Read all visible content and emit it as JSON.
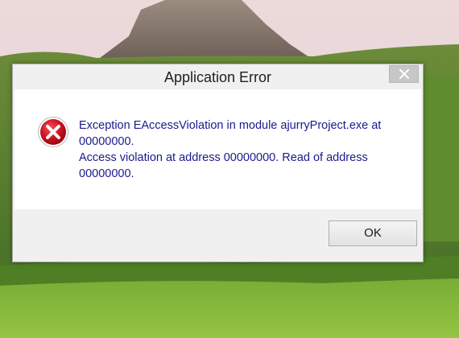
{
  "window": {
    "title": "Application Error"
  },
  "message": {
    "line1": "Exception EAccessViolation in module ajurryProject.exe at",
    "line2": "00000000.",
    "line3": "Access violation at address 00000000. Read of address",
    "line4": "00000000."
  },
  "buttons": {
    "ok_label": "OK"
  },
  "icons": {
    "error": "error-icon",
    "close": "close-icon"
  },
  "colors": {
    "message_text": "#1a1a8c",
    "error_icon": "#c8101e",
    "dialog_background": "#f0f0f0",
    "content_background": "#ffffff"
  }
}
